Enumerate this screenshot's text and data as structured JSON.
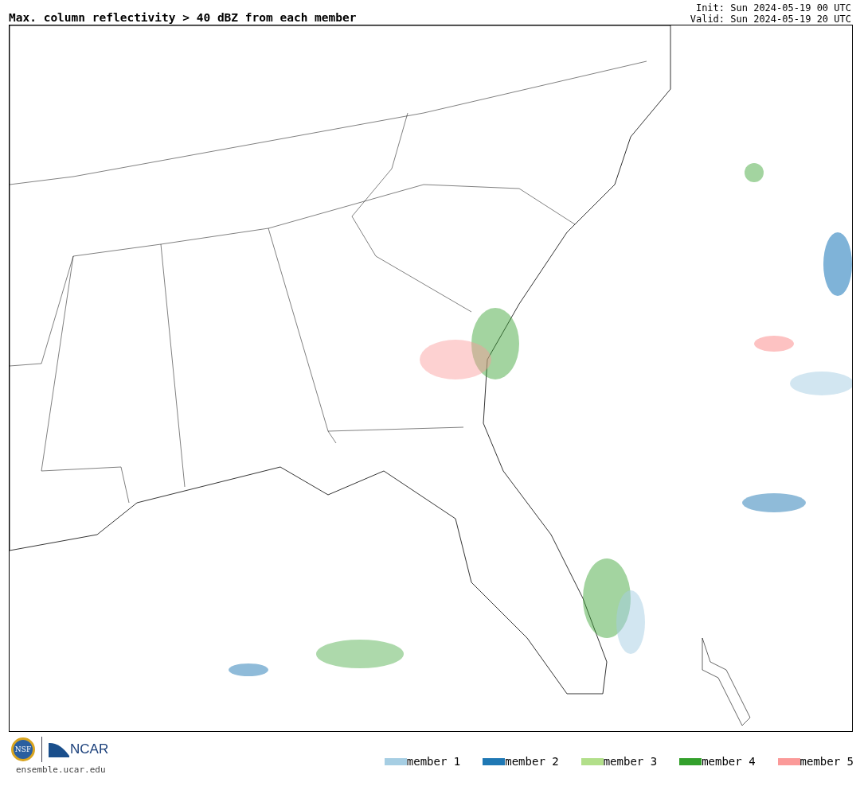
{
  "title": "Max. column reflectivity > 40 dBZ from each member",
  "init": "Init: Sun 2024-05-19 00 UTC",
  "valid": "Valid: Sun 2024-05-19 20 UTC",
  "logos": {
    "nsf": "NSF",
    "ncar": "NCAR"
  },
  "url": "ensemble.ucar.edu",
  "legend": [
    {
      "label": "member 1",
      "color": "#a6cee3"
    },
    {
      "label": "member 2",
      "color": "#1f78b4"
    },
    {
      "label": "member 3",
      "color": "#b2df8a"
    },
    {
      "label": "member 4",
      "color": "#33a02c"
    },
    {
      "label": "member 5",
      "color": "#fb9a99"
    }
  ]
}
